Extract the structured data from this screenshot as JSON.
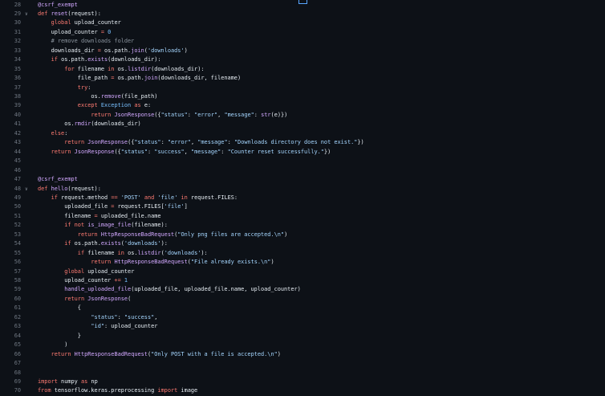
{
  "editor": {
    "lines": [
      {
        "n": "28",
        "fold": "",
        "t": [
          [
            "d",
            "@csrf_exempt"
          ]
        ]
      },
      {
        "n": "29",
        "fold": "v",
        "t": [
          [
            "k",
            "def "
          ],
          [
            "f",
            "reset"
          ],
          [
            "",
            "(request):"
          ]
        ]
      },
      {
        "n": "30",
        "fold": "",
        "t": [
          [
            "",
            "    "
          ],
          [
            "k",
            "global"
          ],
          [
            "",
            " upload_counter"
          ]
        ]
      },
      {
        "n": "31",
        "fold": "",
        "t": [
          [
            "",
            "    upload_counter "
          ],
          [
            "o",
            "="
          ],
          [
            "",
            " "
          ],
          [
            "b",
            "0"
          ]
        ]
      },
      {
        "n": "32",
        "fold": "",
        "t": [
          [
            "",
            "    "
          ],
          [
            "c",
            "# remove downloads folder"
          ]
        ]
      },
      {
        "n": "33",
        "fold": "",
        "t": [
          [
            "",
            "    downloads_dir "
          ],
          [
            "o",
            "="
          ],
          [
            "",
            " os.path."
          ],
          [
            "f",
            "join"
          ],
          [
            "",
            "("
          ],
          [
            "s",
            "'downloads'"
          ],
          [
            "",
            ")"
          ]
        ]
      },
      {
        "n": "34",
        "fold": "",
        "t": [
          [
            "",
            "    "
          ],
          [
            "k",
            "if"
          ],
          [
            "",
            " os.path."
          ],
          [
            "f",
            "exists"
          ],
          [
            "",
            "(downloads_dir):"
          ]
        ]
      },
      {
        "n": "35",
        "fold": "",
        "t": [
          [
            "",
            "        "
          ],
          [
            "k",
            "for"
          ],
          [
            "",
            " filename "
          ],
          [
            "k",
            "in"
          ],
          [
            "",
            " os."
          ],
          [
            "f",
            "listdir"
          ],
          [
            "",
            "(downloads_dir):"
          ]
        ]
      },
      {
        "n": "36",
        "fold": "",
        "t": [
          [
            "",
            "            file_path "
          ],
          [
            "o",
            "="
          ],
          [
            "",
            " os.path."
          ],
          [
            "f",
            "join"
          ],
          [
            "",
            "(downloads_dir, filename)"
          ]
        ]
      },
      {
        "n": "37",
        "fold": "",
        "t": [
          [
            "",
            "            "
          ],
          [
            "k",
            "try"
          ],
          [
            "",
            ":"
          ]
        ]
      },
      {
        "n": "38",
        "fold": "",
        "t": [
          [
            "",
            "                os."
          ],
          [
            "f",
            "remove"
          ],
          [
            "",
            "(file_path)"
          ]
        ]
      },
      {
        "n": "39",
        "fold": "",
        "t": [
          [
            "",
            "            "
          ],
          [
            "k",
            "except"
          ],
          [
            "",
            " "
          ],
          [
            "b",
            "Exception"
          ],
          [
            "",
            " "
          ],
          [
            "k",
            "as"
          ],
          [
            "",
            " e:"
          ]
        ]
      },
      {
        "n": "40",
        "fold": "",
        "t": [
          [
            "",
            "                "
          ],
          [
            "k",
            "return"
          ],
          [
            "",
            " "
          ],
          [
            "f",
            "JsonResponse"
          ],
          [
            "",
            "({"
          ],
          [
            "s",
            "\"status\""
          ],
          [
            "",
            ": "
          ],
          [
            "s",
            "\"error\""
          ],
          [
            "",
            ", "
          ],
          [
            "s",
            "\"message\""
          ],
          [
            "",
            ": "
          ],
          [
            "f",
            "str"
          ],
          [
            "",
            "(e)})"
          ]
        ]
      },
      {
        "n": "41",
        "fold": "",
        "t": [
          [
            "",
            "        os."
          ],
          [
            "f",
            "rmdir"
          ],
          [
            "",
            "(downloads_dir)"
          ]
        ]
      },
      {
        "n": "42",
        "fold": "",
        "t": [
          [
            "",
            "    "
          ],
          [
            "k",
            "else"
          ],
          [
            "",
            ":"
          ]
        ]
      },
      {
        "n": "43",
        "fold": "",
        "t": [
          [
            "",
            "        "
          ],
          [
            "k",
            "return"
          ],
          [
            "",
            " "
          ],
          [
            "f",
            "JsonResponse"
          ],
          [
            "",
            "({"
          ],
          [
            "s",
            "\"status\""
          ],
          [
            "",
            ": "
          ],
          [
            "s",
            "\"error\""
          ],
          [
            "",
            ", "
          ],
          [
            "s",
            "\"message\""
          ],
          [
            "",
            ": "
          ],
          [
            "s",
            "\"Downloads directory does not exist.\""
          ],
          [
            "",
            "})"
          ]
        ]
      },
      {
        "n": "44",
        "fold": "",
        "t": [
          [
            "",
            "    "
          ],
          [
            "k",
            "return"
          ],
          [
            "",
            " "
          ],
          [
            "f",
            "JsonResponse"
          ],
          [
            "",
            "({"
          ],
          [
            "s",
            "\"status\""
          ],
          [
            "",
            ": "
          ],
          [
            "s",
            "\"success\""
          ],
          [
            "",
            ", "
          ],
          [
            "s",
            "\"message\""
          ],
          [
            "",
            ": "
          ],
          [
            "s",
            "\"Counter reset successfully.\""
          ],
          [
            "",
            "})"
          ]
        ]
      },
      {
        "n": "45",
        "fold": "",
        "t": []
      },
      {
        "n": "46",
        "fold": "",
        "t": []
      },
      {
        "n": "47",
        "fold": "",
        "t": [
          [
            "d",
            "@csrf_exempt"
          ]
        ]
      },
      {
        "n": "48",
        "fold": "v",
        "t": [
          [
            "k",
            "def "
          ],
          [
            "f",
            "hello"
          ],
          [
            "",
            "(request):"
          ]
        ]
      },
      {
        "n": "49",
        "fold": "",
        "t": [
          [
            "",
            "    "
          ],
          [
            "k",
            "if"
          ],
          [
            "",
            " request.method "
          ],
          [
            "o",
            "=="
          ],
          [
            "",
            " "
          ],
          [
            "s",
            "'POST'"
          ],
          [
            "",
            " "
          ],
          [
            "k",
            "and"
          ],
          [
            "",
            " "
          ],
          [
            "s",
            "'file'"
          ],
          [
            "",
            " "
          ],
          [
            "k",
            "in"
          ],
          [
            "",
            " request.FILES:"
          ]
        ]
      },
      {
        "n": "50",
        "fold": "",
        "t": [
          [
            "",
            "        uploaded_file "
          ],
          [
            "o",
            "="
          ],
          [
            "",
            " request.FILES["
          ],
          [
            "s",
            "'file'"
          ],
          [
            "",
            "]"
          ]
        ]
      },
      {
        "n": "51",
        "fold": "",
        "t": [
          [
            "",
            "        filename "
          ],
          [
            "o",
            "="
          ],
          [
            "",
            " uploaded_file.name"
          ]
        ]
      },
      {
        "n": "52",
        "fold": "",
        "t": [
          [
            "",
            "        "
          ],
          [
            "k",
            "if not"
          ],
          [
            "",
            " "
          ],
          [
            "f",
            "is_image_file"
          ],
          [
            "",
            "(filename):"
          ]
        ]
      },
      {
        "n": "53",
        "fold": "",
        "t": [
          [
            "",
            "            "
          ],
          [
            "k",
            "return"
          ],
          [
            "",
            " "
          ],
          [
            "f",
            "HttpResponseBadRequest"
          ],
          [
            "",
            "("
          ],
          [
            "s",
            "\"Only png files are accepted.\\n\""
          ],
          [
            "",
            ")"
          ]
        ]
      },
      {
        "n": "54",
        "fold": "",
        "t": [
          [
            "",
            "        "
          ],
          [
            "k",
            "if"
          ],
          [
            "",
            " os.path."
          ],
          [
            "f",
            "exists"
          ],
          [
            "",
            "("
          ],
          [
            "s",
            "'downloads'"
          ],
          [
            "",
            "):"
          ]
        ]
      },
      {
        "n": "55",
        "fold": "",
        "t": [
          [
            "",
            "            "
          ],
          [
            "k",
            "if"
          ],
          [
            "",
            " filename "
          ],
          [
            "k",
            "in"
          ],
          [
            "",
            " os."
          ],
          [
            "f",
            "listdir"
          ],
          [
            "",
            "("
          ],
          [
            "s",
            "'downloads'"
          ],
          [
            "",
            "):"
          ]
        ]
      },
      {
        "n": "56",
        "fold": "",
        "t": [
          [
            "",
            "                "
          ],
          [
            "k",
            "return"
          ],
          [
            "",
            " "
          ],
          [
            "f",
            "HttpResponseBadRequest"
          ],
          [
            "",
            "("
          ],
          [
            "s",
            "\"File already exists.\\n\""
          ],
          [
            "",
            ")"
          ]
        ]
      },
      {
        "n": "57",
        "fold": "",
        "t": [
          [
            "",
            "        "
          ],
          [
            "k",
            "global"
          ],
          [
            "",
            " upload_counter"
          ]
        ]
      },
      {
        "n": "58",
        "fold": "",
        "t": [
          [
            "",
            "        upload_counter "
          ],
          [
            "o",
            "+="
          ],
          [
            "",
            " "
          ],
          [
            "b",
            "1"
          ]
        ]
      },
      {
        "n": "59",
        "fold": "",
        "t": [
          [
            "",
            "        "
          ],
          [
            "f",
            "handle_uploaded_file"
          ],
          [
            "",
            "(uploaded_file, uploaded_file.name, upload_counter)"
          ]
        ]
      },
      {
        "n": "60",
        "fold": "",
        "t": [
          [
            "",
            "        "
          ],
          [
            "k",
            "return"
          ],
          [
            "",
            " "
          ],
          [
            "f",
            "JsonResponse"
          ],
          [
            "",
            "("
          ]
        ]
      },
      {
        "n": "61",
        "fold": "",
        "t": [
          [
            "",
            "            {"
          ]
        ]
      },
      {
        "n": "62",
        "fold": "",
        "t": [
          [
            "",
            "                "
          ],
          [
            "s",
            "\"status\""
          ],
          [
            "",
            ": "
          ],
          [
            "s",
            "\"success\""
          ],
          [
            "",
            ","
          ]
        ]
      },
      {
        "n": "63",
        "fold": "",
        "t": [
          [
            "",
            "                "
          ],
          [
            "s",
            "\"id\""
          ],
          [
            "",
            ": upload_counter"
          ]
        ]
      },
      {
        "n": "64",
        "fold": "",
        "t": [
          [
            "",
            "            }"
          ]
        ]
      },
      {
        "n": "65",
        "fold": "",
        "t": [
          [
            "",
            "        )"
          ]
        ]
      },
      {
        "n": "66",
        "fold": "",
        "t": [
          [
            "",
            "    "
          ],
          [
            "k",
            "return"
          ],
          [
            "",
            " "
          ],
          [
            "f",
            "HttpResponseBadRequest"
          ],
          [
            "",
            "("
          ],
          [
            "s",
            "\"Only POST with a file is accepted.\\n\""
          ],
          [
            "",
            ")"
          ]
        ]
      },
      {
        "n": "67",
        "fold": "",
        "t": []
      },
      {
        "n": "68",
        "fold": "",
        "t": []
      },
      {
        "n": "69",
        "fold": "",
        "t": [
          [
            "k",
            "import"
          ],
          [
            "",
            " numpy "
          ],
          [
            "k",
            "as"
          ],
          [
            "",
            " np"
          ]
        ]
      },
      {
        "n": "70",
        "fold": "",
        "t": [
          [
            "k",
            "from"
          ],
          [
            "",
            " tensorflow.keras.preprocessing "
          ],
          [
            "k",
            "import"
          ],
          [
            "",
            " image"
          ]
        ]
      }
    ]
  }
}
